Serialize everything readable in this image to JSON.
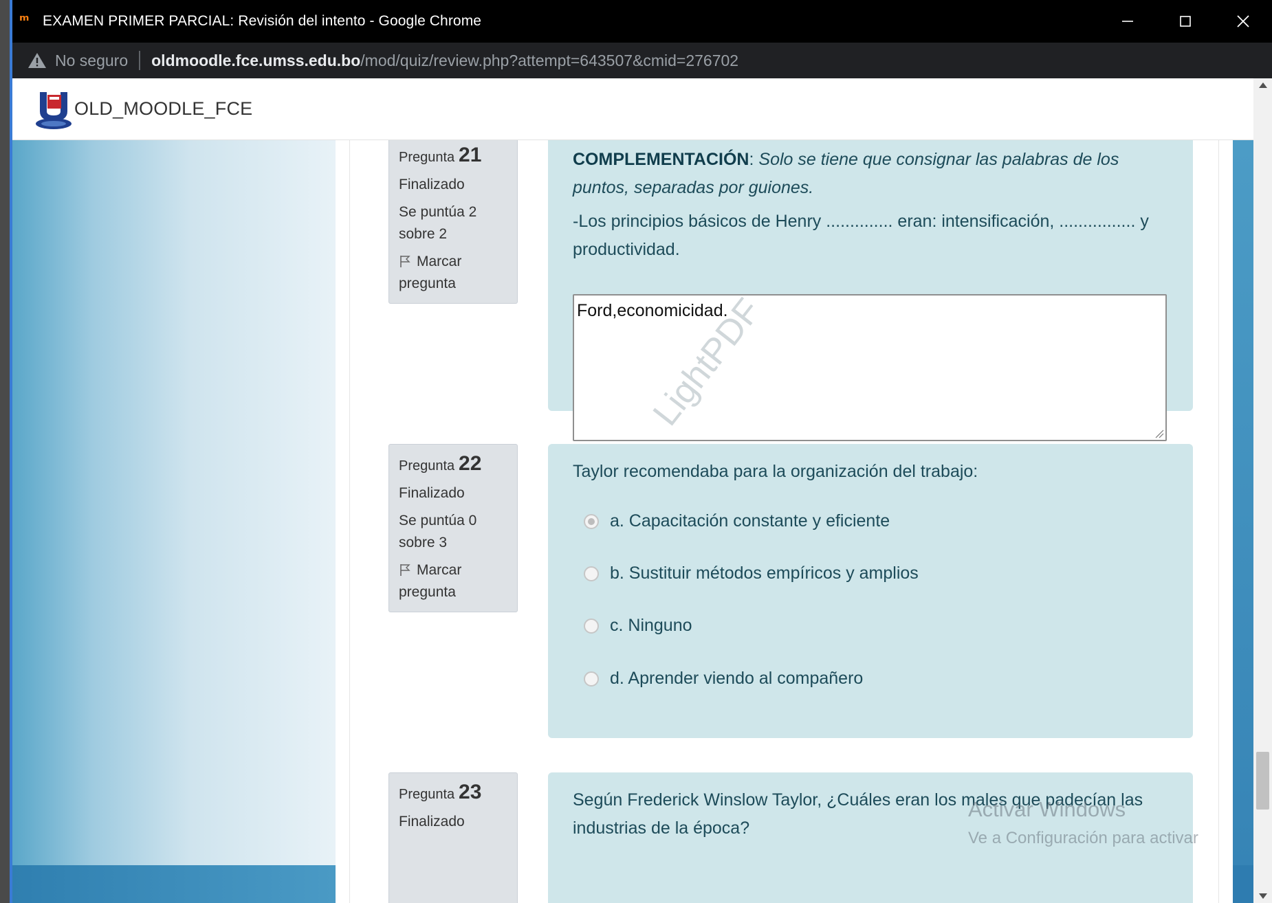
{
  "window": {
    "title": "EXAMEN PRIMER PARCIAL: Revisión del intento - Google Chrome",
    "app_icon_text": "m"
  },
  "address_bar": {
    "security_label": "No seguro",
    "host": "oldmoodle.fce.umss.edu.bo",
    "path": "/mod/quiz/review.php?attempt=643507&cmid=276702"
  },
  "site": {
    "brand": "OLD_MOODLE_FCE"
  },
  "questions": [
    {
      "label": "Pregunta",
      "number": "21",
      "state": "Finalizado",
      "grade": "Se puntúa 2 sobre 2",
      "flag": "Marcar pregunta",
      "heading_bold": "COMPLEMENTACIÓN",
      "heading_colon": ": ",
      "heading_italic": "Solo se tiene que consignar las palabras de los puntos, separadas por guiones.",
      "text": "-Los principios básicos de Henry .............. eran: intensificación, ................ y productividad.",
      "answer": "Ford,economicidad."
    },
    {
      "label": "Pregunta",
      "number": "22",
      "state": "Finalizado",
      "grade": "Se puntúa 0 sobre 3",
      "flag": "Marcar pregunta",
      "text": "Taylor recomendaba para la organización del trabajo:",
      "options": [
        {
          "label": "a. Capacitación constante y eficiente",
          "checked": true
        },
        {
          "label": "b. Sustituir métodos empíricos y amplios",
          "checked": false
        },
        {
          "label": "c. Ninguno",
          "checked": false
        },
        {
          "label": "d. Aprender viendo al compañero",
          "checked": false
        }
      ]
    },
    {
      "label": "Pregunta",
      "number": "23",
      "state": "Finalizado",
      "text": "Según Frederick Winslow Taylor, ¿Cuáles eran los males que padecían las industrias de la época?"
    }
  ],
  "overlays": {
    "watermark": "LightPDF",
    "activate_title": "Activar Windows",
    "activate_sub": "Ve a Configuración para activar"
  },
  "colors": {
    "question_bg": "#cfe6ea",
    "info_bg": "#dee2e6",
    "question_text": "#1d4b59"
  }
}
